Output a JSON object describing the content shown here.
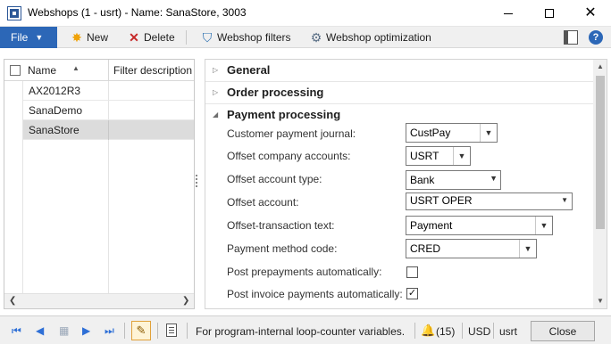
{
  "window": {
    "title": "Webshops (1 - usrt) - Name: SanaStore, 3003",
    "minimize_glyph": "—",
    "close_glyph": "✕"
  },
  "toolbar": {
    "file_label": "File",
    "new_label": "New",
    "delete_label": "Delete",
    "filters_label": "Webshop filters",
    "optimization_label": "Webshop optimization",
    "help_glyph": "?"
  },
  "grid": {
    "columns": [
      "Name",
      "Filter description"
    ],
    "sort_indicator": "▲",
    "rows": [
      {
        "name": "AX2012R3",
        "selected": false
      },
      {
        "name": "SanaDemo",
        "selected": false
      },
      {
        "name": "SanaStore",
        "selected": true
      }
    ]
  },
  "form": {
    "groups": {
      "general": {
        "label": "General",
        "expanded": false
      },
      "order": {
        "label": "Order processing",
        "expanded": false
      },
      "payment": {
        "label": "Payment processing",
        "expanded": true
      }
    },
    "fields": {
      "customer_payment_journal": {
        "label": "Customer payment journal:",
        "value": "CustPay"
      },
      "offset_company_accounts": {
        "label": "Offset company accounts:",
        "value": "USRT"
      },
      "offset_account_type": {
        "label": "Offset account type:",
        "value": "Bank"
      },
      "offset_account": {
        "label": "Offset account:",
        "value": "USRT OPER"
      },
      "offset_transaction_text": {
        "label": "Offset-transaction text:",
        "value": "Payment"
      },
      "payment_method_code": {
        "label": "Payment method code:",
        "value": "CRED"
      },
      "post_prepayments": {
        "label": "Post prepayments automatically:",
        "checked": false
      },
      "post_invoice_payments": {
        "label": "Post invoice payments automatically:",
        "checked": true,
        "check_glyph": "✓"
      }
    }
  },
  "statusbar": {
    "message": "For program-internal loop-counter variables.",
    "notifications": "(15)",
    "currency": "USD",
    "company": "usrt",
    "close_label": "Close"
  },
  "colors": {
    "accent": "#2c67b7",
    "selected_row": "#dcdcdc",
    "nav_blue": "#2e6fd6"
  }
}
